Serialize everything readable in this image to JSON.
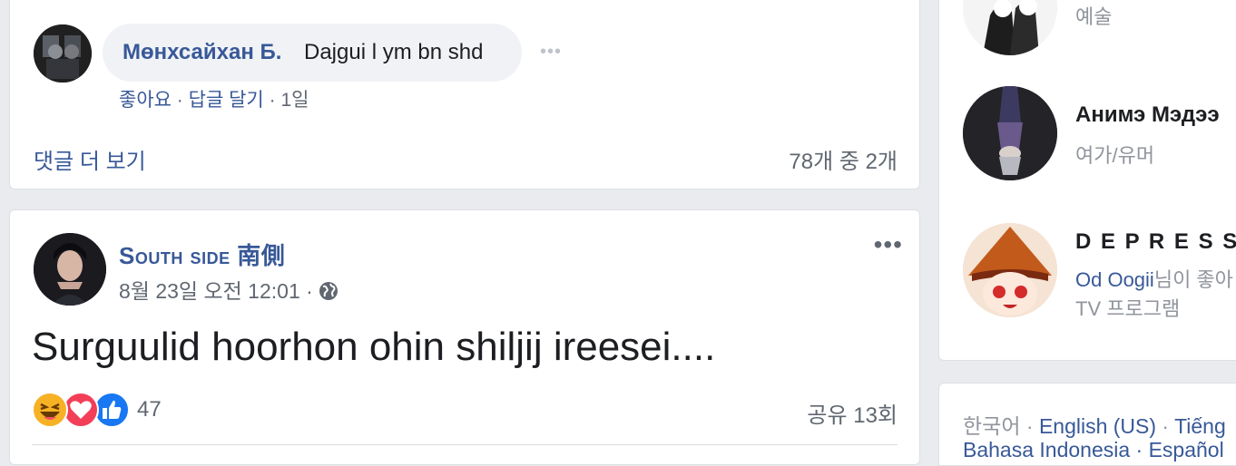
{
  "comment": {
    "author": "Мөнхсайхан Б.",
    "text": "Dajgui l ym bn shd",
    "more_icon": "more-horizontal-icon",
    "like": "좋아요",
    "reply": "답글 달기",
    "time": "1일",
    "separator": " · "
  },
  "comments_footer": {
    "more_label": "댓글 더 보기",
    "count_label": "78개 중 2개"
  },
  "post": {
    "author": "South side 南側",
    "timestamp": "8월 23일 오전 12:01",
    "separator": " · ",
    "privacy_icon": "globe-icon",
    "options_icon": "more-horizontal-icon",
    "text": "Surguulid hoorhon ohin shiljij ireesei....",
    "reaction_icons": [
      "haha-reaction-icon",
      "love-reaction-icon",
      "like-reaction-icon"
    ],
    "reaction_count": "47",
    "share_label": "공유 13회"
  },
  "sidebar": {
    "pages": [
      {
        "name": "",
        "category": "예술"
      },
      {
        "name": "Анимэ Мэдээ",
        "category": "여가/유머"
      },
      {
        "name": "D E P R E S S E",
        "friend": "Od Oogii",
        "friend_suffix": "님이 좋아",
        "category": "TV 프로그램"
      }
    ]
  },
  "languages": {
    "line1_current": "한국어",
    "line1_sep": " · ",
    "line1_en": "English (US)",
    "line1_sep2": " · ",
    "line1_next": "Tiếng",
    "line2": "Bahasa Indonesia · Español"
  },
  "colors": {
    "link": "#385898",
    "background": "#e9ebee",
    "muted": "#606770",
    "love": "#f33e58",
    "like": "#1877f2",
    "haha": "#f7b125"
  }
}
